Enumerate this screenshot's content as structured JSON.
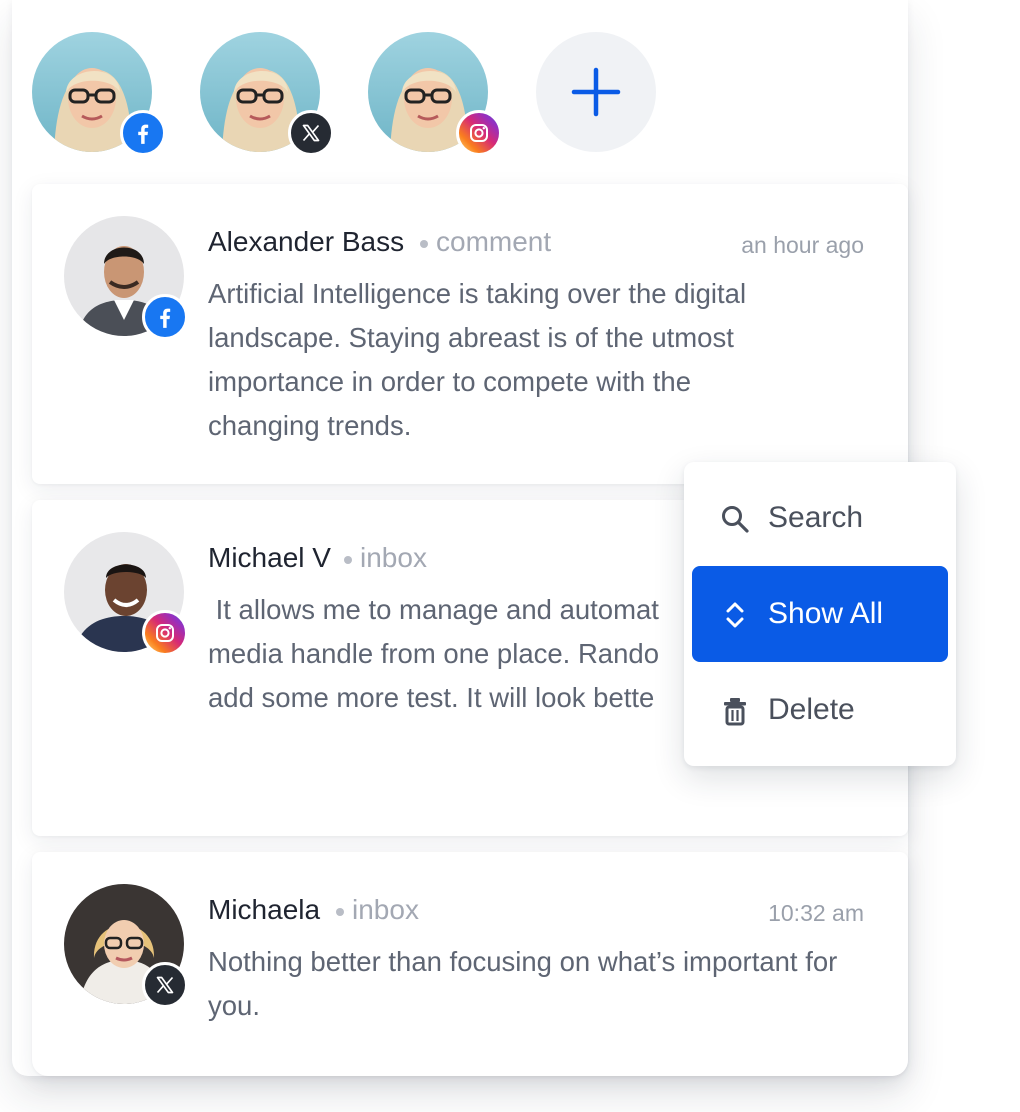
{
  "accounts": [
    {
      "platform": "facebook",
      "icon": "facebook-icon"
    },
    {
      "platform": "x",
      "icon": "x-icon"
    },
    {
      "platform": "instagram",
      "icon": "instagram-icon"
    }
  ],
  "add_account": {
    "icon": "plus-icon"
  },
  "posts": [
    {
      "author": "Alexander Bass",
      "type": "comment",
      "time": "an hour ago",
      "platform": "facebook",
      "message": "Artificial Intelligence is taking over the digital landscape. Staying abreast is of the utmost importance in order to compete with the changing trends."
    },
    {
      "author": "Michael V",
      "type": "inbox",
      "platform": "instagram",
      "message_lines": [
        " It allows me to manage and automat",
        "media handle from one place. Rando",
        "add some more test. It will look bette"
      ]
    },
    {
      "author": "Michaela",
      "type": "inbox",
      "time": "10:32 am",
      "platform": "x",
      "message": "Nothing better than focusing on what’s important for you."
    }
  ],
  "context_menu": {
    "items": [
      {
        "label": "Search",
        "icon": "search-icon",
        "active": false
      },
      {
        "label": "Show All",
        "icon": "expand-icon",
        "active": true
      },
      {
        "label": "Delete",
        "icon": "trash-icon",
        "active": false
      }
    ]
  },
  "colors": {
    "accent": "#0a5be6",
    "facebook": "#1877F2",
    "x": "#262b33",
    "card_bg": "#ffffff",
    "muted_text": "#5e6573"
  }
}
